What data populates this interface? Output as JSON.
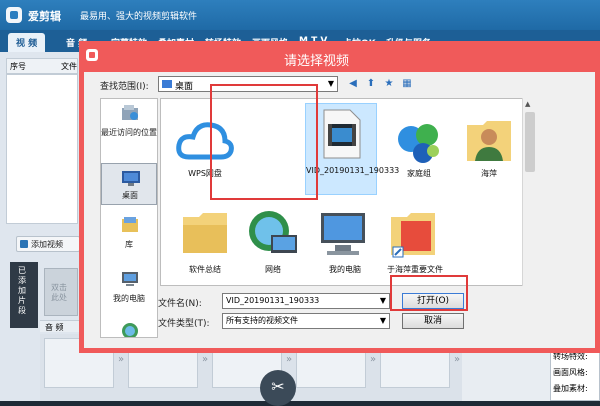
{
  "app": {
    "name": "爱剪辑",
    "slogan": "最易用、强大的视频剪辑软件",
    "tabs": [
      "视 频",
      "音 频",
      "字幕特效",
      "叠加素材",
      "转场特效",
      "画面风格",
      "M T V",
      "卡拉OK",
      "升级与服务"
    ],
    "list_headers": [
      "序号",
      "文件"
    ],
    "add_video_label": "添加视频",
    "added_clips_label": "已添加片段",
    "clip_placeholder": "双击\n此处",
    "audio_label": "音 频",
    "info_lines": [
      "转场特效:",
      "画面风格:",
      "叠加素材:"
    ]
  },
  "dialog": {
    "title": "请选择视频",
    "look_in_label": "查找范围(I):",
    "look_in_value": "桌面",
    "places": [
      {
        "label": "最近访问的位置",
        "icon": "recent-places-icon"
      },
      {
        "label": "桌面",
        "icon": "desktop-icon"
      },
      {
        "label": "库",
        "icon": "library-icon"
      },
      {
        "label": "我的电脑",
        "icon": "computer-icon"
      },
      {
        "label": "网络",
        "icon": "network-icon"
      }
    ],
    "files": [
      {
        "label": "WPS网盘",
        "icon": "cloud-icon"
      },
      {
        "label": "VID_20190131_190333",
        "icon": "video-file-icon",
        "selected": true
      },
      {
        "label": "家庭组",
        "icon": "homegroup-icon"
      },
      {
        "label": "海萍",
        "icon": "user-folder-icon"
      },
      {
        "label": "软件总结",
        "icon": "folder-icon"
      },
      {
        "label": "网络",
        "icon": "network-globe-icon"
      },
      {
        "label": "我的电脑",
        "icon": "computer-icon"
      },
      {
        "label": "于海萍重要文件",
        "icon": "shortcut-folder-icon"
      }
    ],
    "filename_label": "文件名(N):",
    "filename_value": "VID_20190131_190333",
    "filetype_label": "文件类型(T):",
    "filetype_value": "所有支持的视频文件",
    "open_label": "打开(O)",
    "cancel_label": "取消"
  },
  "colors": {
    "dialog_border": "#f05a5a",
    "highlight": "#e03a3a",
    "accent": "#2a74b5"
  }
}
